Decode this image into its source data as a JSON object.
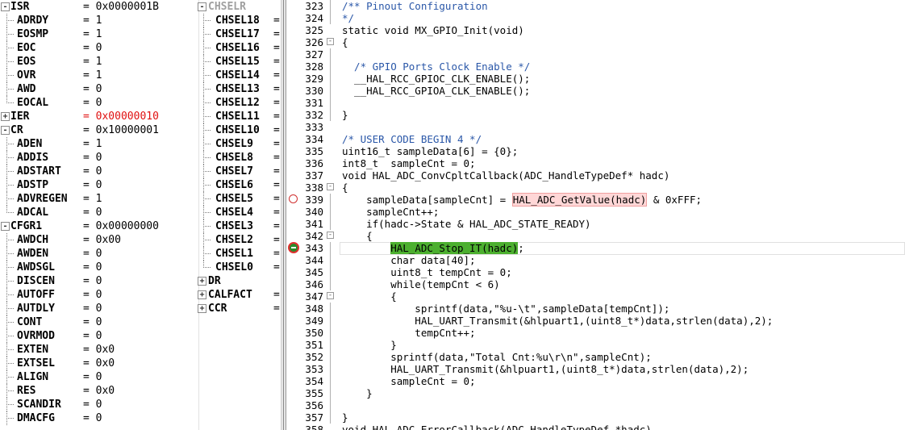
{
  "registers_left": [
    {
      "name": "ISR",
      "value": "= 0x0000001B",
      "group": true,
      "state": "-"
    },
    {
      "name": "ADRDY",
      "value": "= 1"
    },
    {
      "name": "EOSMP",
      "value": "= 1"
    },
    {
      "name": "EOC",
      "value": "= 0"
    },
    {
      "name": "EOS",
      "value": "= 1"
    },
    {
      "name": "OVR",
      "value": "= 1"
    },
    {
      "name": "AWD",
      "value": "= 0"
    },
    {
      "name": "EOCAL",
      "value": "= 0",
      "last": true
    },
    {
      "name": "IER",
      "value": "= 0x00000010",
      "group": true,
      "state": "+",
      "changed": true
    },
    {
      "name": "CR",
      "value": "= 0x10000001",
      "group": true,
      "state": "-"
    },
    {
      "name": "ADEN",
      "value": "= 1"
    },
    {
      "name": "ADDIS",
      "value": "= 0"
    },
    {
      "name": "ADSTART",
      "value": "= 0"
    },
    {
      "name": "ADSTP",
      "value": "= 0"
    },
    {
      "name": "ADVREGEN",
      "value": "= 1"
    },
    {
      "name": "ADCAL",
      "value": "= 0",
      "last": true
    },
    {
      "name": "CFGR1",
      "value": "= 0x00000000",
      "group": true,
      "state": "-"
    },
    {
      "name": "AWDCH",
      "value": "= 0x00"
    },
    {
      "name": "AWDEN",
      "value": "= 0"
    },
    {
      "name": "AWDSGL",
      "value": "= 0"
    },
    {
      "name": "DISCEN",
      "value": "= 0"
    },
    {
      "name": "AUTOFF",
      "value": "= 0"
    },
    {
      "name": "AUTDLY",
      "value": "= 0"
    },
    {
      "name": "CONT",
      "value": "= 0"
    },
    {
      "name": "OVRMOD",
      "value": "= 0"
    },
    {
      "name": "EXTEN",
      "value": "= 0x0"
    },
    {
      "name": "EXTSEL",
      "value": "= 0x0"
    },
    {
      "name": "ALIGN",
      "value": "= 0"
    },
    {
      "name": "RES",
      "value": "= 0x0"
    },
    {
      "name": "SCANDIR",
      "value": "= 0"
    },
    {
      "name": "DMACFG",
      "value": "= 0"
    }
  ],
  "registers_right": [
    {
      "name": "CHSELR",
      "value": "",
      "group": true,
      "state": "-",
      "grey": true
    },
    {
      "name": "CHSEL18",
      "value": "="
    },
    {
      "name": "CHSEL17",
      "value": "="
    },
    {
      "name": "CHSEL16",
      "value": "="
    },
    {
      "name": "CHSEL15",
      "value": "="
    },
    {
      "name": "CHSEL14",
      "value": "="
    },
    {
      "name": "CHSEL13",
      "value": "="
    },
    {
      "name": "CHSEL12",
      "value": "="
    },
    {
      "name": "CHSEL11",
      "value": "="
    },
    {
      "name": "CHSEL10",
      "value": "="
    },
    {
      "name": "CHSEL9",
      "value": "="
    },
    {
      "name": "CHSEL8",
      "value": "="
    },
    {
      "name": "CHSEL7",
      "value": "="
    },
    {
      "name": "CHSEL6",
      "value": "="
    },
    {
      "name": "CHSEL5",
      "value": "="
    },
    {
      "name": "CHSEL4",
      "value": "="
    },
    {
      "name": "CHSEL3",
      "value": "="
    },
    {
      "name": "CHSEL2",
      "value": "="
    },
    {
      "name": "CHSEL1",
      "value": "="
    },
    {
      "name": "CHSEL0",
      "value": "=",
      "last": true
    },
    {
      "name": "DR",
      "value": "",
      "group": true,
      "state": "+"
    },
    {
      "name": "CALFACT",
      "value": "=",
      "group": true,
      "state": "+"
    },
    {
      "name": "CCR",
      "value": "=",
      "group": true,
      "state": "+"
    }
  ],
  "code_lines": [
    {
      "n": "323",
      "t": "/** Pinout Configuration",
      "cls": "cmt",
      "fold": "line"
    },
    {
      "n": "324",
      "t": "*/",
      "cls": "cmt",
      "fold": "line"
    },
    {
      "n": "325",
      "t": "static void MX_GPIO_Init(void)"
    },
    {
      "n": "326",
      "t": "{",
      "fold": "box"
    },
    {
      "n": "327",
      "t": "",
      "fold": "line"
    },
    {
      "n": "328",
      "t": "  /* GPIO Ports Clock Enable */",
      "cls": "cmt",
      "fold": "line"
    },
    {
      "n": "329",
      "t": "  __HAL_RCC_GPIOC_CLK_ENABLE();",
      "fold": "line"
    },
    {
      "n": "330",
      "t": "  __HAL_RCC_GPIOA_CLK_ENABLE();",
      "fold": "line"
    },
    {
      "n": "331",
      "t": "",
      "fold": "line"
    },
    {
      "n": "332",
      "t": "}",
      "fold": "line"
    },
    {
      "n": "333",
      "t": ""
    },
    {
      "n": "334",
      "t": "/* USER CODE BEGIN 4 */",
      "cls": "cmt"
    },
    {
      "n": "335",
      "t": "uint16_t sampleData[6] = {0};"
    },
    {
      "n": "336",
      "t": "int8_t  sampleCnt = 0;"
    },
    {
      "n": "337",
      "t": "void HAL_ADC_ConvCpltCallback(ADC_HandleTypeDef* hadc)"
    },
    {
      "n": "338",
      "t": "{",
      "fold": "box"
    },
    {
      "n": "339",
      "pre": "    sampleData[sampleCnt] = ",
      "mid": "HAL_ADC_GetValue(hadc)",
      "post": " & 0xFFF;",
      "midcls": "hl-red",
      "marker": "bp",
      "fold": "line"
    },
    {
      "n": "340",
      "t": "    sampleCnt++;",
      "fold": "line"
    },
    {
      "n": "341",
      "t": "    if(hadc->State & HAL_ADC_STATE_READY)",
      "fold": "line"
    },
    {
      "n": "342",
      "t": "    {",
      "fold": "box"
    },
    {
      "n": "343",
      "pre": "        ",
      "mid": "HAL_ADC_Stop_IT(hadc)",
      "post": ";",
      "midcls": "hl-green",
      "marker": "pc",
      "fold": "line",
      "cur": true
    },
    {
      "n": "344",
      "t": "        char data[40];",
      "fold": "line"
    },
    {
      "n": "345",
      "t": "        uint8_t tempCnt = 0;",
      "fold": "line"
    },
    {
      "n": "346",
      "t": "        while(tempCnt < 6)",
      "fold": "line"
    },
    {
      "n": "347",
      "t": "        {",
      "fold": "box"
    },
    {
      "n": "348",
      "t": "            sprintf(data,\"%u-\\t\",sampleData[tempCnt]);",
      "fold": "line"
    },
    {
      "n": "349",
      "t": "            HAL_UART_Transmit(&hlpuart1,(uint8_t*)data,strlen(data),2);",
      "fold": "line"
    },
    {
      "n": "350",
      "t": "            tempCnt++;",
      "fold": "line"
    },
    {
      "n": "351",
      "t": "        }",
      "fold": "line"
    },
    {
      "n": "352",
      "t": "        sprintf(data,\"Total Cnt:%u\\r\\n\",sampleCnt);",
      "fold": "line"
    },
    {
      "n": "353",
      "t": "        HAL_UART_Transmit(&hlpuart1,(uint8_t*)data,strlen(data),2);",
      "fold": "line"
    },
    {
      "n": "354",
      "t": "        sampleCnt = 0;",
      "fold": "line"
    },
    {
      "n": "355",
      "t": "    }",
      "fold": "line"
    },
    {
      "n": "356",
      "t": "",
      "fold": "line"
    },
    {
      "n": "357",
      "t": "}",
      "fold": "line"
    },
    {
      "n": "358",
      "t": "void HAL_ADC_ErrorCallback(ADC_HandleTypeDef *hadc)"
    }
  ]
}
